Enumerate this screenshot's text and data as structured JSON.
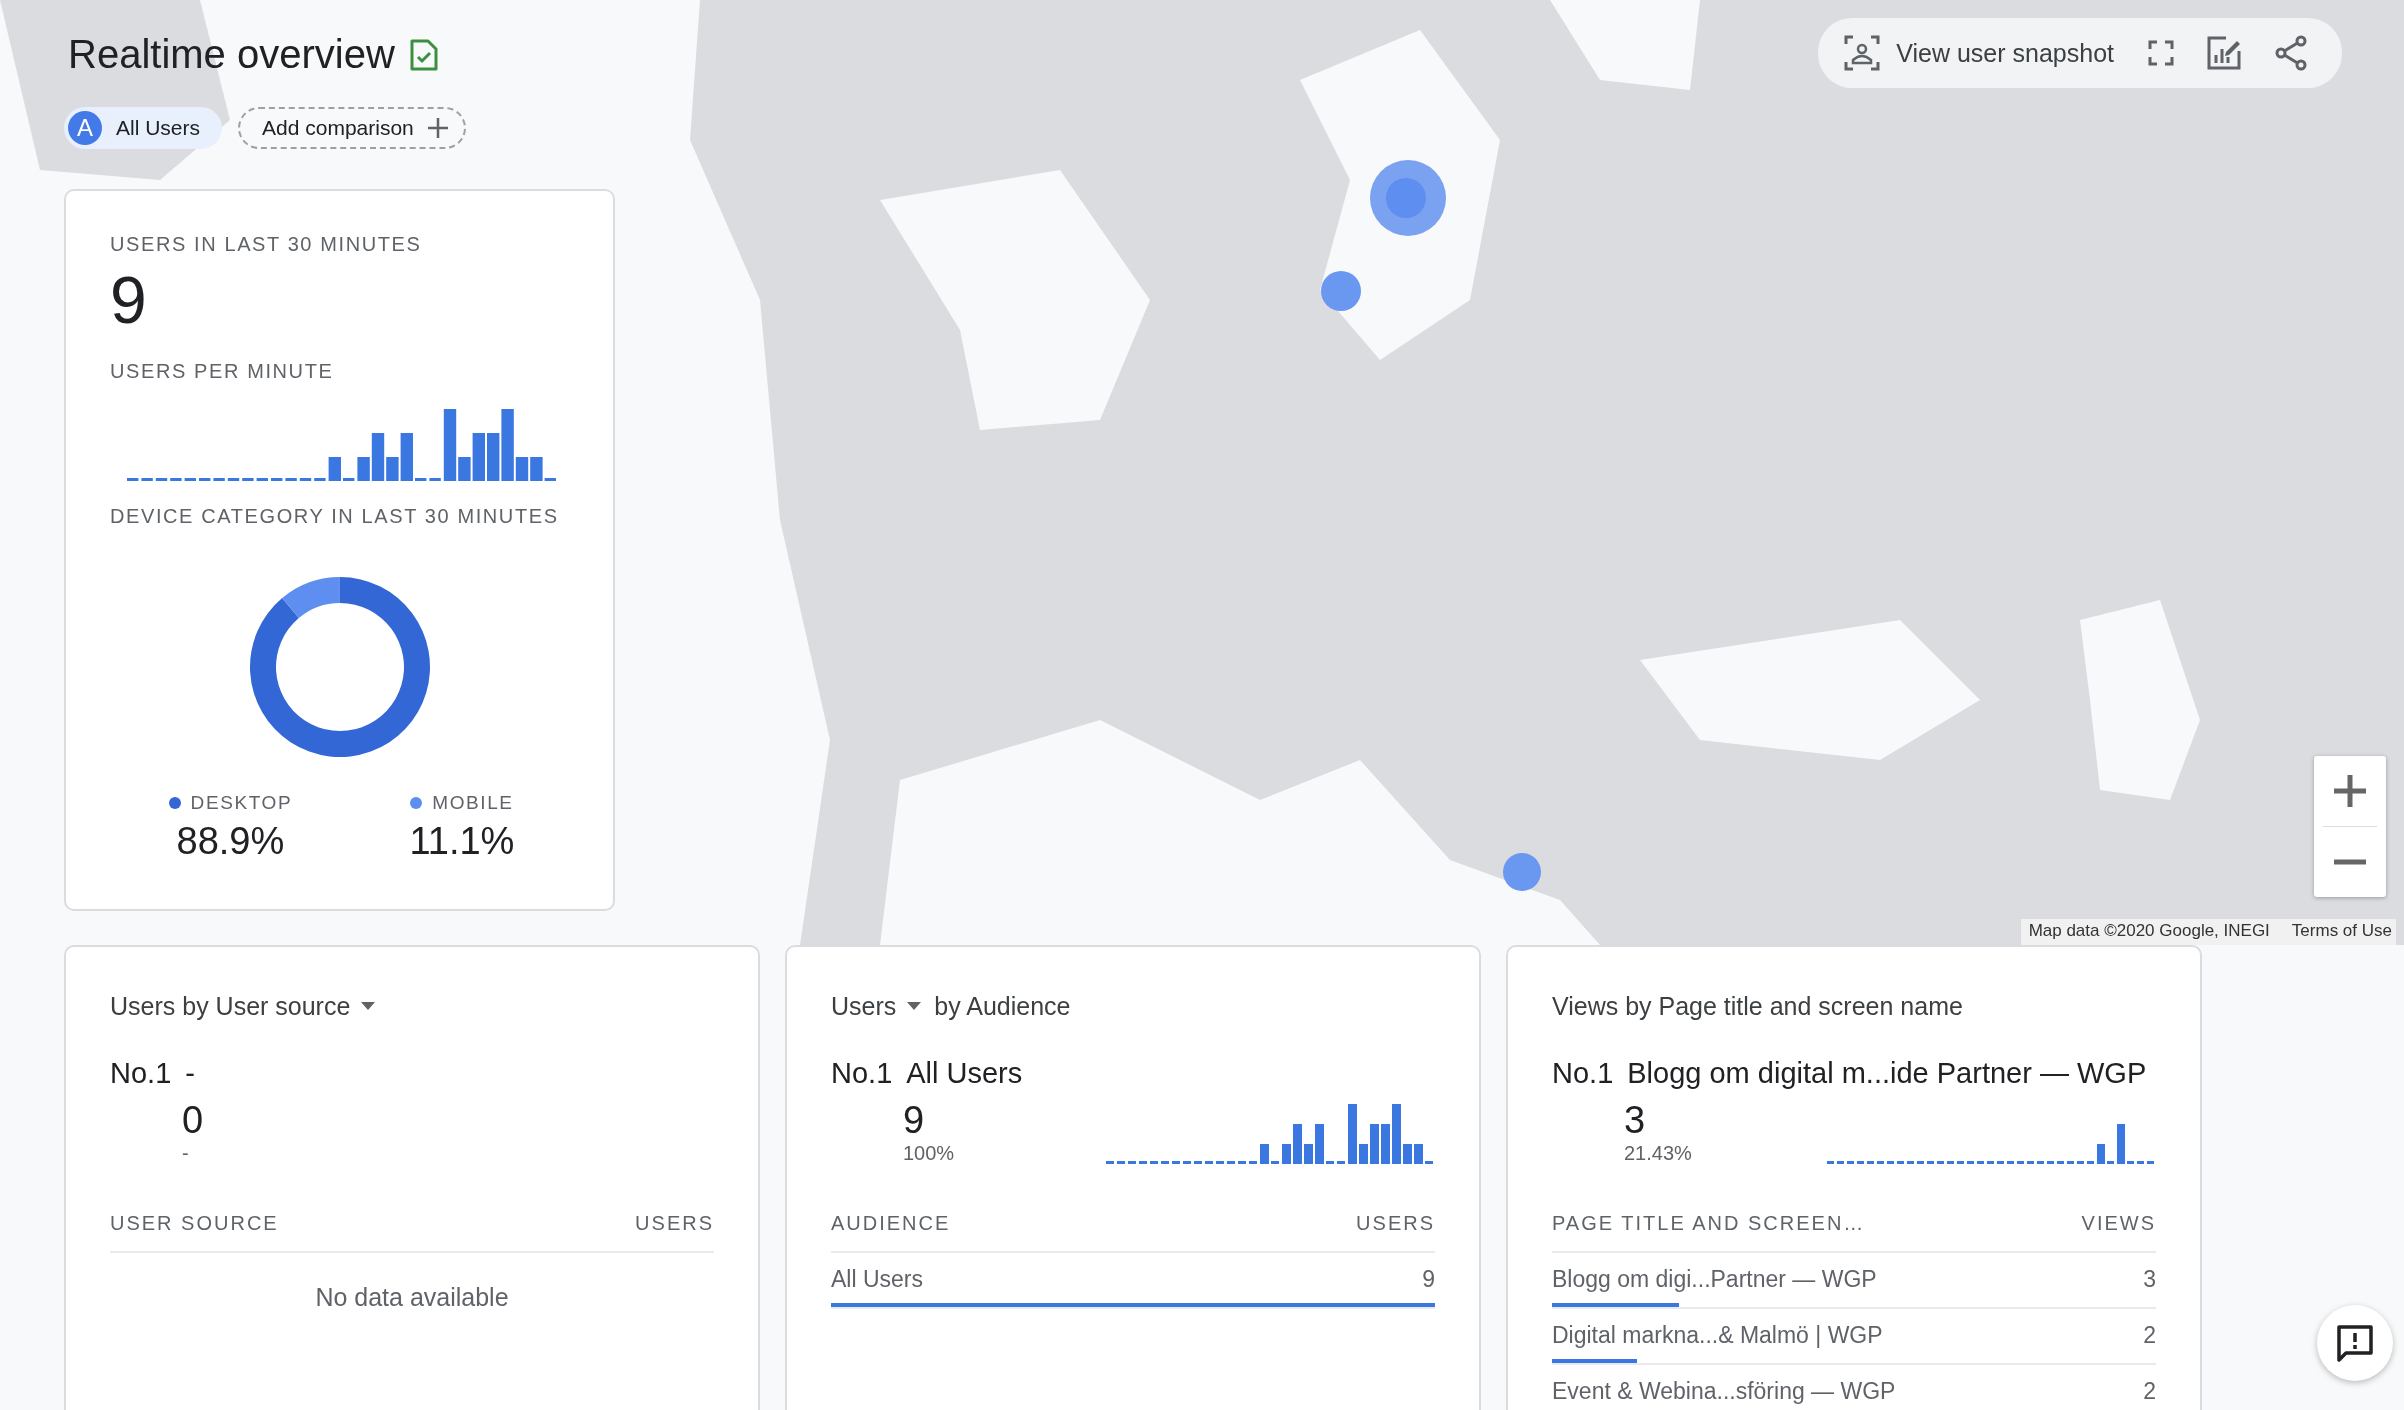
{
  "header": {
    "title": "Realtime overview",
    "comparisons": [
      {
        "avatar": "A",
        "label": "All Users"
      }
    ],
    "add_comparison": "Add comparison"
  },
  "toolbar": {
    "snapshot_button": "View user snapshot"
  },
  "map": {
    "attribution": "Map data ©2020 Google, INEGI",
    "terms_link": "Terms of Use"
  },
  "summary_card": {
    "users_label": "USERS IN LAST 30 MINUTES",
    "users_value": "9",
    "per_minute_label": "USERS PER MINUTE",
    "device_label": "DEVICE CATEGORY IN LAST 30 MINUTES",
    "chart_data": {
      "type": "donut",
      "categories": [
        "DESKTOP",
        "MOBILE"
      ],
      "values": [
        88.9,
        11.1
      ]
    },
    "legend": [
      {
        "value": "88.9%",
        "color": "#3367d6"
      },
      {
        "value": "11.1%",
        "color": "#5e8ef0"
      }
    ]
  },
  "cards": [
    {
      "title": [
        {
          "text": "Users by User source",
          "dropdown": true
        }
      ],
      "rank": "No.1",
      "name": "-",
      "value": "0",
      "share": "-",
      "sparkline": false,
      "columns": [
        "USER SOURCE",
        "USERS"
      ],
      "empty_message": "No data available"
    },
    {
      "title": [
        {
          "text": "Users",
          "dropdown": true
        },
        {
          "text": "by Audience",
          "dropdown": false
        }
      ],
      "rank": "No.1",
      "name": "All Users",
      "value": "9",
      "share": "100%",
      "sparkline": true,
      "columns": [
        "AUDIENCE",
        "USERS"
      ],
      "rows": [
        {
          "label": "All Users",
          "value": "9",
          "level": 1
        }
      ]
    },
    {
      "title": [
        {
          "text": "Views by Page title and screen name",
          "dropdown": false
        }
      ],
      "rank": "No.1",
      "name": "Blogg om digital m...ide Partner — WGP",
      "value": "3",
      "share": "21.43%",
      "sparkline": true,
      "columns": [
        "PAGE TITLE AND SCREEN…",
        "VIEWS"
      ],
      "rows": [
        {
          "label": "Blogg om digi...Partner — WGP",
          "value": "3",
          "level": 0.21
        },
        {
          "label": "Digital markna...& Malmö | WGP",
          "value": "2",
          "level": 0.14
        },
        {
          "label": "Event & Webina...sföring — WGP",
          "value": "2"
        }
      ]
    }
  ]
}
